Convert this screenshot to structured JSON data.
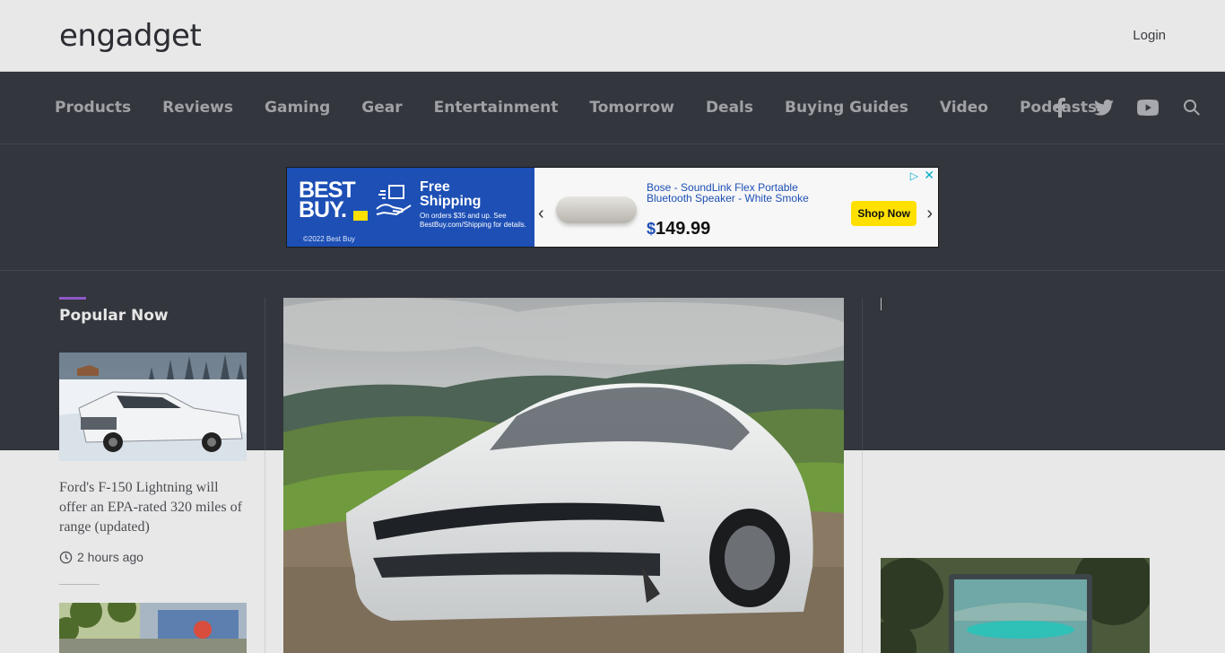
{
  "header": {
    "logo": "engadget",
    "login_label": "Login"
  },
  "nav": {
    "items": [
      "Products",
      "Reviews",
      "Gaming",
      "Gear",
      "Entertainment",
      "Tomorrow",
      "Deals",
      "Buying Guides",
      "Video",
      "Podcasts"
    ],
    "icons": [
      "facebook-icon",
      "twitter-icon",
      "youtube-icon",
      "search-icon"
    ]
  },
  "ad": {
    "brand": "BEST BUY",
    "headline": "Free Shipping",
    "fine_print": "On orders $35 and up. See BestBuy.com/Shipping for details.",
    "copyright": "©2022 Best Buy",
    "product_title": "Bose - SoundLink Flex Portable Bluetooth Speaker - White Smoke",
    "price_currency": "$",
    "price_value": "149.99",
    "cta_label": "Shop Now",
    "brand_color": "#1d4fb5",
    "cta_color": "#ffe000"
  },
  "popular": {
    "title": "Popular Now",
    "accent_color": "#8e58c8",
    "items": [
      {
        "headline": "Ford's F-150 Lightning will offer an EPA-rated 320 miles of range (updated)",
        "time": "2 hours ago"
      }
    ]
  },
  "colors": {
    "nav_bg": "#33363d",
    "page_bg": "#e8e8e8"
  }
}
